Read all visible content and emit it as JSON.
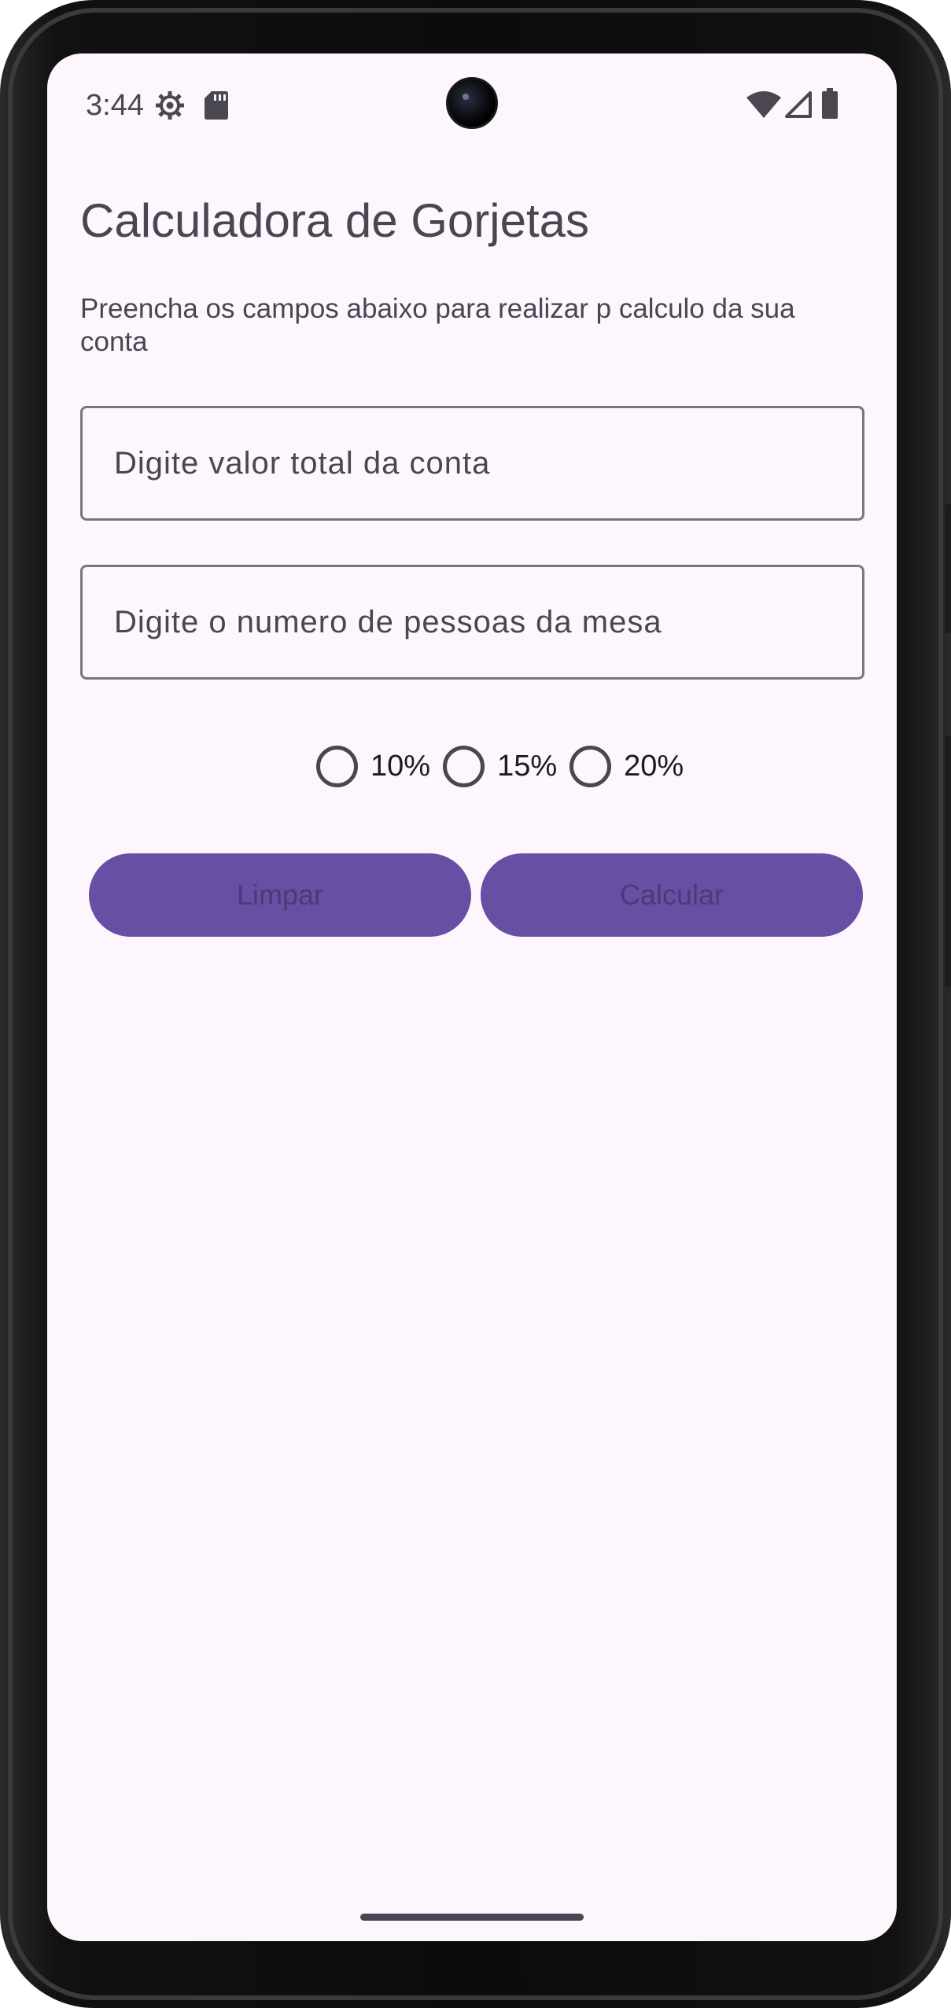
{
  "status_bar": {
    "time": "3:44",
    "left_icons": [
      "settings-gear-icon",
      "sd-card-icon"
    ],
    "right_icons": [
      "wifi-icon",
      "cell-signal-icon",
      "battery-icon"
    ]
  },
  "app": {
    "title": "Calculadora de Gorjetas",
    "subtitle": "Preencha os campos abaixo para realizar p calculo da sua conta",
    "bill_field": {
      "placeholder": "Digite valor total da conta",
      "value": ""
    },
    "people_field": {
      "placeholder": "Digite o numero de pessoas da mesa",
      "value": ""
    },
    "tip_options": [
      {
        "label": "10%",
        "selected": false
      },
      {
        "label": "15%",
        "selected": false
      },
      {
        "label": "20%",
        "selected": false
      }
    ],
    "buttons": {
      "clear_label": "Limpar",
      "calculate_label": "Calcular"
    }
  },
  "colors": {
    "background": "#fdf6fc",
    "primary": "#6750a4",
    "on_surface": "#4a4553"
  }
}
